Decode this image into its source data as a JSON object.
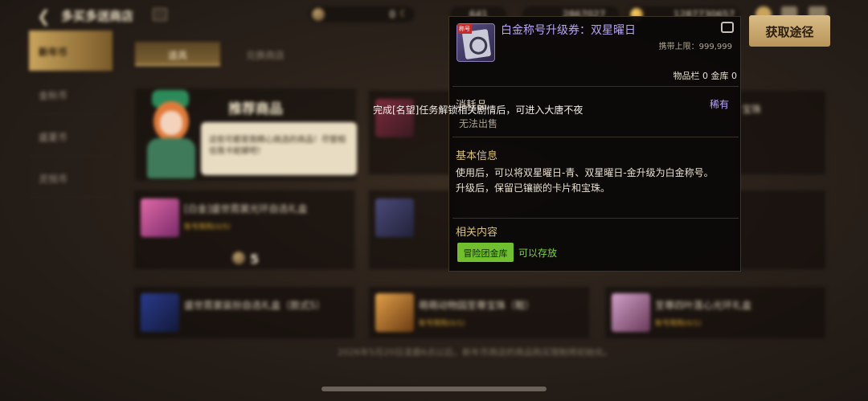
{
  "header": {
    "title": "多买多送商店",
    "currency_zero": "0",
    "currency_b": "641",
    "currency_c": "2867027",
    "currency_d": "1287730657"
  },
  "left_nav": {
    "items": [
      {
        "label": "新年币"
      },
      {
        "label": "金秋币"
      },
      {
        "label": "盛夏币"
      },
      {
        "label": "灵悦币"
      }
    ]
  },
  "tabs": [
    {
      "label": "道具"
    },
    {
      "label": "兑换商店"
    }
  ],
  "recommend": {
    "title": "推荐商品",
    "bubble_text": "这些可都是我精心挑选的商品！尽管相信我卡妮娜吧！"
  },
  "products": [
    {
      "name": "[白金]盛世霓裳光环自选礼盒",
      "limit": "账号限购(0/5)",
      "price": "5"
    },
    {
      "name": "盛世霓裳装扮自选礼盒（款式5）",
      "limit": "账号限购(0/1)"
    },
    {
      "name": "萌萌动物园至尊宝珠（鞋）",
      "limit": "账号限购(0/1)"
    },
    {
      "name": "至尊四叶莲心光环礼盒",
      "limit": "账号限购(0/1)"
    },
    {
      "name": "宝珠"
    }
  ],
  "footer_note": "2026年5月20日凌晨6点以后，新年币商店的商品购买限制将初始化。",
  "tooltip": {
    "item_name": "白金称号升级券：双星曜日",
    "carry_limit": "携带上限：999,999",
    "storage": "物品栏 0 金库 0",
    "category": "消耗品",
    "rarity": "稀有",
    "sell_status": "无法出售",
    "basic_info_header": "基本信息",
    "desc_line1": "使用后，可以将双星曜日-青、双星曜日-金升级为白金称号。",
    "desc_line2": "升级后，保留已镶嵌的卡片和宝珠。",
    "related_header": "相关内容",
    "related_badge": "冒险团金库",
    "related_status": "可以存放",
    "icon_tag": "称号"
  },
  "get_button": "获取途径",
  "quest_hint": "完成[名望]任务解锁相关剧情后，可进入大唐不夜",
  "colors": {
    "rare": "#b7a6f6",
    "gold": "#d9c279",
    "green": "#7ed33e",
    "button": "#cfb07a"
  }
}
